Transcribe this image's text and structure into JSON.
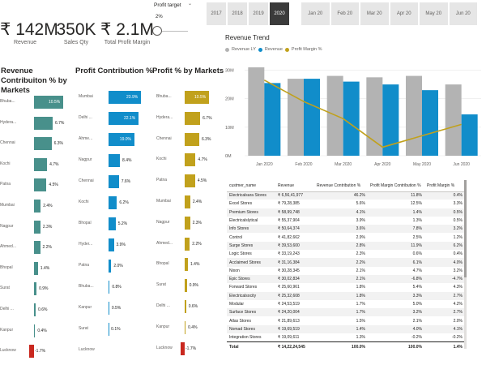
{
  "kpis": [
    {
      "value": "₹ 142M",
      "label": "Revenue"
    },
    {
      "value": "350K",
      "label": "Sales Qty"
    },
    {
      "value": "₹ 2.1M",
      "label": "Total Profit Margin"
    }
  ],
  "profit_target": {
    "title": "Profit target",
    "value": "2%",
    "caret": "⌄",
    "level": 0.05
  },
  "years": [
    "2017",
    "2018",
    "2019",
    "2020"
  ],
  "selected_year": "2020",
  "months": [
    "Jan 20",
    "Feb 20",
    "Mar 20",
    "Apr 20",
    "May 20",
    "Jun 20"
  ],
  "colors": {
    "teal": "#48908b",
    "blue": "#118dca",
    "gold": "#c1a11c",
    "red": "#c9281f",
    "grey": "#b3b3b3",
    "dark": "#3b3b3b"
  },
  "panels": {
    "revenue": {
      "title": "Revenue Contribuiton % by Markets",
      "rows": [
        {
          "cat": "Bhuba...",
          "val": 10.5,
          "label": "10.5%"
        },
        {
          "cat": "Hydera...",
          "val": 6.7,
          "label": "6.7%"
        },
        {
          "cat": "Chennai",
          "val": 6.3,
          "label": "6.3%"
        },
        {
          "cat": "Kochi",
          "val": 4.7,
          "label": "4.7%"
        },
        {
          "cat": "Patna",
          "val": 4.5,
          "label": "4.5%"
        },
        {
          "cat": "Mumbai",
          "val": 2.4,
          "label": "2.4%"
        },
        {
          "cat": "Nagpur",
          "val": 2.3,
          "label": "2.3%"
        },
        {
          "cat": "Ahmed...",
          "val": 2.2,
          "label": "2.2%"
        },
        {
          "cat": "Bhopal",
          "val": 1.4,
          "label": "1.4%"
        },
        {
          "cat": "Surat",
          "val": 0.9,
          "label": "0.9%"
        },
        {
          "cat": "Delhi ...",
          "val": 0.6,
          "label": "0.6%"
        },
        {
          "cat": "Kanpur",
          "val": 0.4,
          "label": "0.4%"
        },
        {
          "cat": "Lucknow",
          "val": 1.7,
          "label": "-1.7%",
          "neg": true
        }
      ]
    },
    "profit": {
      "title": "Profit Contribution %",
      "rows": [
        {
          "cat": "Mumbai",
          "val": 23.9,
          "label": "23.9%"
        },
        {
          "cat": "Delhi ...",
          "val": 22.1,
          "label": "22.1%"
        },
        {
          "cat": "Ahme...",
          "val": 19.0,
          "label": "19.0%"
        },
        {
          "cat": "Nagpur",
          "val": 8.4,
          "label": "8.4%"
        },
        {
          "cat": "Chennai",
          "val": 7.6,
          "label": "7.6%"
        },
        {
          "cat": "Kochi",
          "val": 6.2,
          "label": "6.2%"
        },
        {
          "cat": "Bhopal",
          "val": 5.2,
          "label": "5.2%"
        },
        {
          "cat": "Hyder...",
          "val": 3.9,
          "label": "3.9%"
        },
        {
          "cat": "Patna",
          "val": 2.0,
          "label": "2.0%"
        },
        {
          "cat": "Bhuba...",
          "val": 0.8,
          "label": "0.8%"
        },
        {
          "cat": "Kanpur",
          "val": 0.5,
          "label": "0.5%"
        },
        {
          "cat": "Surat",
          "val": 0.1,
          "label": "0.1%"
        },
        {
          "cat": "Lucknow",
          "val": 0.0,
          "label": ""
        }
      ]
    },
    "margin": {
      "title": "Profit % by Markets",
      "rows": [
        {
          "cat": "Bhuba...",
          "val": 10.5,
          "label": "10.5%"
        },
        {
          "cat": "Hydera...",
          "val": 6.7,
          "label": "6.7%"
        },
        {
          "cat": "Chennai",
          "val": 6.3,
          "label": "6.3%"
        },
        {
          "cat": "Kochi",
          "val": 4.7,
          "label": "4.7%"
        },
        {
          "cat": "Patna",
          "val": 4.5,
          "label": "4.5%"
        },
        {
          "cat": "Mumbai",
          "val": 2.4,
          "label": "2.4%"
        },
        {
          "cat": "Nagpur",
          "val": 2.3,
          "label": "2.3%"
        },
        {
          "cat": "Ahmed...",
          "val": 2.2,
          "label": "2.2%"
        },
        {
          "cat": "Bhopal",
          "val": 1.4,
          "label": "1.4%"
        },
        {
          "cat": "Surat",
          "val": 0.9,
          "label": "0.9%"
        },
        {
          "cat": "Delhi ...",
          "val": 0.6,
          "label": "0.6%"
        },
        {
          "cat": "Kanpur",
          "val": 0.4,
          "label": "0.4%"
        },
        {
          "cat": "Lucknow",
          "val": 1.7,
          "label": "-1.7%",
          "neg": true
        }
      ]
    }
  },
  "chart_data": {
    "type": "bar",
    "title": "Revenue Trend",
    "categories": [
      "Jan 2020",
      "Feb 2020",
      "Mar 2020",
      "Apr 2020",
      "May 2020",
      "Jun 2020"
    ],
    "series": [
      {
        "name": "Revenue LY",
        "values": [
          31,
          27,
          28,
          27.5,
          28,
          25
        ]
      },
      {
        "name": "Revenue",
        "values": [
          25.5,
          27,
          26,
          25,
          23,
          14.5
        ]
      },
      {
        "name": "Profit Margin %",
        "values": [
          26.5,
          19,
          13,
          3,
          7,
          11
        ]
      }
    ],
    "yticks": [
      "30M",
      "20M",
      "10M",
      "0M"
    ],
    "ylim": [
      0,
      33
    ],
    "legend": "top-left"
  },
  "table": {
    "headers": [
      "custmer_name",
      "Revenue",
      "Revenue Contribution %",
      "Profit Margin Contribution %",
      "Profit Margin %"
    ],
    "rows": [
      [
        "Electricalsara Stores",
        "₹ 6,56,41,977",
        "46.2%",
        "11.8%",
        "0.4%"
      ],
      [
        "Excel Stores",
        "₹ 79,28,385",
        "5.6%",
        "12.5%",
        "3.3%"
      ],
      [
        "Premium Stores",
        "₹ 58,99,748",
        "4.1%",
        "1.4%",
        "0.5%"
      ],
      [
        "Electricalslytical",
        "₹ 55,37,904",
        "3.9%",
        "1.3%",
        "0.5%"
      ],
      [
        "Info Stores",
        "₹ 50,64,374",
        "3.6%",
        "7.8%",
        "3.2%"
      ],
      [
        "Control",
        "₹ 41,82,662",
        "2.9%",
        "2.5%",
        "1.2%"
      ],
      [
        "Surge Stores",
        "₹ 39,53,600",
        "2.8%",
        "11.9%",
        "6.2%"
      ],
      [
        "Logic Stores",
        "₹ 33,19,243",
        "2.3%",
        "0.6%",
        "0.4%"
      ],
      [
        "Acclaimed Stores",
        "₹ 31,16,384",
        "2.2%",
        "6.1%",
        "4.0%"
      ],
      [
        "Nixon",
        "₹ 30,28,345",
        "2.1%",
        "4.7%",
        "3.2%"
      ],
      [
        "Epic Stores",
        "₹ 30,02,834",
        "2.1%",
        "-6.8%",
        "-4.7%"
      ],
      [
        "Forward Stores",
        "₹ 25,60,961",
        "1.8%",
        "5.4%",
        "4.3%"
      ],
      [
        "Electricalsocity",
        "₹ 25,32,608",
        "1.8%",
        "3.3%",
        "2.7%"
      ],
      [
        "Modular",
        "₹ 24,53,519",
        "1.7%",
        "5.0%",
        "4.2%"
      ],
      [
        "Surface Stores",
        "₹ 24,20,004",
        "1.7%",
        "3.2%",
        "2.7%"
      ],
      [
        "Atlas Stores",
        "₹ 21,89,613",
        "1.5%",
        "2.1%",
        "2.0%"
      ],
      [
        "Nomad Stores",
        "₹ 19,69,519",
        "1.4%",
        "4.0%",
        "4.1%"
      ],
      [
        "Integration Stores",
        "₹ 19,09,611",
        "1.3%",
        "-0.2%",
        "-0.2%"
      ]
    ],
    "total": [
      "Total",
      "₹ 14,22,24,545",
      "100.0%",
      "100.0%",
      "1.4%"
    ]
  }
}
